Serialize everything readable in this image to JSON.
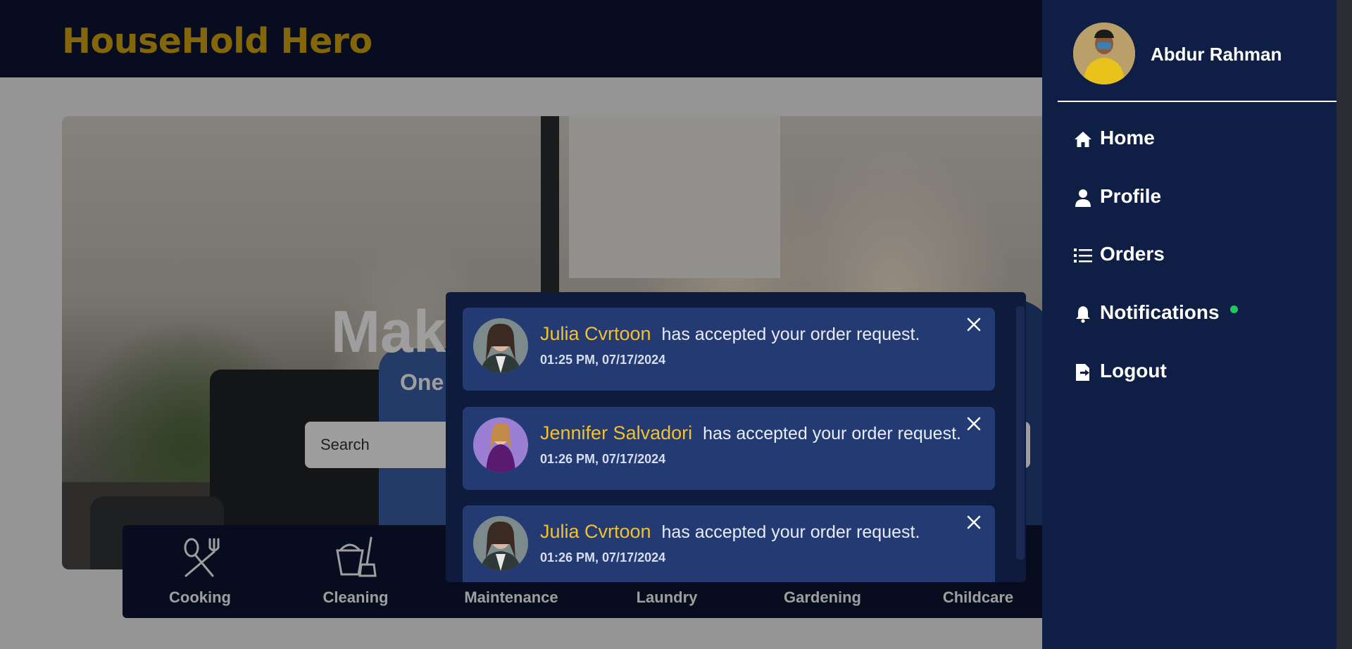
{
  "header": {
    "logo": "HouseHold Hero"
  },
  "hero": {
    "title_visible": "Mak",
    "subtitle_visible": "One",
    "search_placeholder": "Search"
  },
  "categories": [
    {
      "label": "Cooking",
      "icon": "fork-spoon-icon"
    },
    {
      "label": "Cleaning",
      "icon": "bucket-broom-icon"
    },
    {
      "label": "Maintenance",
      "icon": "wrench-icon"
    },
    {
      "label": "Laundry",
      "icon": "washing-machine-icon"
    },
    {
      "label": "Gardening",
      "icon": "plant-icon"
    },
    {
      "label": "Childcare",
      "icon": "baby-icon"
    }
  ],
  "notifications": [
    {
      "name": "Julia Cvrtoon",
      "message": "has accepted your order request.",
      "time": "01:25 PM, 07/17/2024"
    },
    {
      "name": "Jennifer Salvadori",
      "message": "has accepted your order request.",
      "time": "01:26 PM, 07/17/2024"
    },
    {
      "name": "Julia Cvrtoon",
      "message": "has accepted your order request.",
      "time": "01:26 PM, 07/17/2024"
    }
  ],
  "drawer": {
    "user_name": "Abdur Rahman",
    "nav": [
      {
        "label": "Home",
        "icon": "home-icon"
      },
      {
        "label": "Profile",
        "icon": "user-icon"
      },
      {
        "label": "Orders",
        "icon": "list-icon"
      },
      {
        "label": "Notifications",
        "icon": "bell-icon",
        "has_new": true
      },
      {
        "label": "Logout",
        "icon": "logout-icon"
      }
    ]
  },
  "colors": {
    "brand": "#d4a311",
    "navy": "#0c1631",
    "drawer": "#0f1e44",
    "card": "#233a72",
    "name_highlight": "#f2c12e",
    "status_dot": "#22c55e"
  }
}
